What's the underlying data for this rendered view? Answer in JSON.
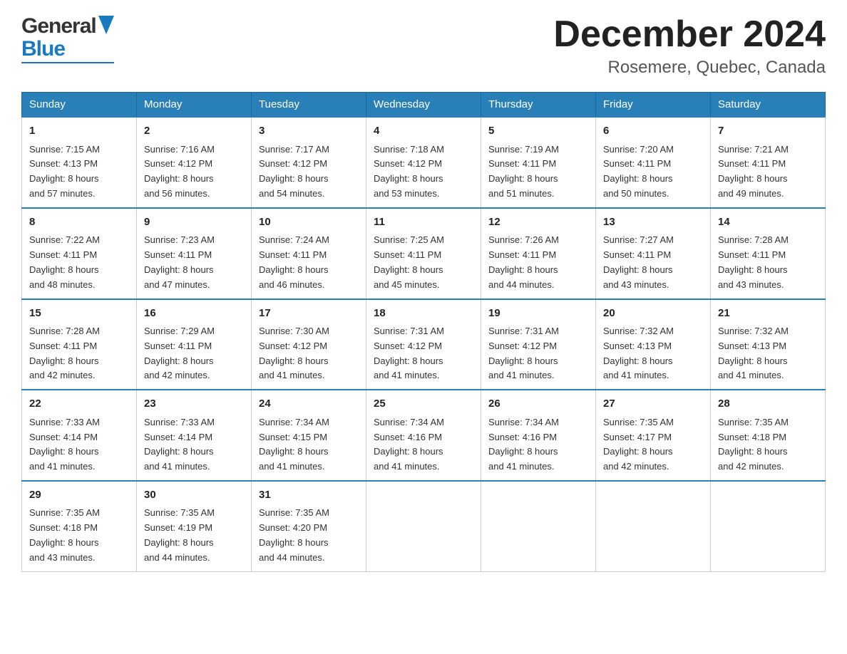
{
  "header": {
    "logo": {
      "general": "General",
      "blue": "Blue"
    },
    "month": "December 2024",
    "location": "Rosemere, Quebec, Canada"
  },
  "weekdays": [
    "Sunday",
    "Monday",
    "Tuesday",
    "Wednesday",
    "Thursday",
    "Friday",
    "Saturday"
  ],
  "weeks": [
    [
      {
        "day": "1",
        "sunrise": "Sunrise: 7:15 AM",
        "sunset": "Sunset: 4:13 PM",
        "daylight": "Daylight: 8 hours",
        "minutes": "and 57 minutes."
      },
      {
        "day": "2",
        "sunrise": "Sunrise: 7:16 AM",
        "sunset": "Sunset: 4:12 PM",
        "daylight": "Daylight: 8 hours",
        "minutes": "and 56 minutes."
      },
      {
        "day": "3",
        "sunrise": "Sunrise: 7:17 AM",
        "sunset": "Sunset: 4:12 PM",
        "daylight": "Daylight: 8 hours",
        "minutes": "and 54 minutes."
      },
      {
        "day": "4",
        "sunrise": "Sunrise: 7:18 AM",
        "sunset": "Sunset: 4:12 PM",
        "daylight": "Daylight: 8 hours",
        "minutes": "and 53 minutes."
      },
      {
        "day": "5",
        "sunrise": "Sunrise: 7:19 AM",
        "sunset": "Sunset: 4:11 PM",
        "daylight": "Daylight: 8 hours",
        "minutes": "and 51 minutes."
      },
      {
        "day": "6",
        "sunrise": "Sunrise: 7:20 AM",
        "sunset": "Sunset: 4:11 PM",
        "daylight": "Daylight: 8 hours",
        "minutes": "and 50 minutes."
      },
      {
        "day": "7",
        "sunrise": "Sunrise: 7:21 AM",
        "sunset": "Sunset: 4:11 PM",
        "daylight": "Daylight: 8 hours",
        "minutes": "and 49 minutes."
      }
    ],
    [
      {
        "day": "8",
        "sunrise": "Sunrise: 7:22 AM",
        "sunset": "Sunset: 4:11 PM",
        "daylight": "Daylight: 8 hours",
        "minutes": "and 48 minutes."
      },
      {
        "day": "9",
        "sunrise": "Sunrise: 7:23 AM",
        "sunset": "Sunset: 4:11 PM",
        "daylight": "Daylight: 8 hours",
        "minutes": "and 47 minutes."
      },
      {
        "day": "10",
        "sunrise": "Sunrise: 7:24 AM",
        "sunset": "Sunset: 4:11 PM",
        "daylight": "Daylight: 8 hours",
        "minutes": "and 46 minutes."
      },
      {
        "day": "11",
        "sunrise": "Sunrise: 7:25 AM",
        "sunset": "Sunset: 4:11 PM",
        "daylight": "Daylight: 8 hours",
        "minutes": "and 45 minutes."
      },
      {
        "day": "12",
        "sunrise": "Sunrise: 7:26 AM",
        "sunset": "Sunset: 4:11 PM",
        "daylight": "Daylight: 8 hours",
        "minutes": "and 44 minutes."
      },
      {
        "day": "13",
        "sunrise": "Sunrise: 7:27 AM",
        "sunset": "Sunset: 4:11 PM",
        "daylight": "Daylight: 8 hours",
        "minutes": "and 43 minutes."
      },
      {
        "day": "14",
        "sunrise": "Sunrise: 7:28 AM",
        "sunset": "Sunset: 4:11 PM",
        "daylight": "Daylight: 8 hours",
        "minutes": "and 43 minutes."
      }
    ],
    [
      {
        "day": "15",
        "sunrise": "Sunrise: 7:28 AM",
        "sunset": "Sunset: 4:11 PM",
        "daylight": "Daylight: 8 hours",
        "minutes": "and 42 minutes."
      },
      {
        "day": "16",
        "sunrise": "Sunrise: 7:29 AM",
        "sunset": "Sunset: 4:11 PM",
        "daylight": "Daylight: 8 hours",
        "minutes": "and 42 minutes."
      },
      {
        "day": "17",
        "sunrise": "Sunrise: 7:30 AM",
        "sunset": "Sunset: 4:12 PM",
        "daylight": "Daylight: 8 hours",
        "minutes": "and 41 minutes."
      },
      {
        "day": "18",
        "sunrise": "Sunrise: 7:31 AM",
        "sunset": "Sunset: 4:12 PM",
        "daylight": "Daylight: 8 hours",
        "minutes": "and 41 minutes."
      },
      {
        "day": "19",
        "sunrise": "Sunrise: 7:31 AM",
        "sunset": "Sunset: 4:12 PM",
        "daylight": "Daylight: 8 hours",
        "minutes": "and 41 minutes."
      },
      {
        "day": "20",
        "sunrise": "Sunrise: 7:32 AM",
        "sunset": "Sunset: 4:13 PM",
        "daylight": "Daylight: 8 hours",
        "minutes": "and 41 minutes."
      },
      {
        "day": "21",
        "sunrise": "Sunrise: 7:32 AM",
        "sunset": "Sunset: 4:13 PM",
        "daylight": "Daylight: 8 hours",
        "minutes": "and 41 minutes."
      }
    ],
    [
      {
        "day": "22",
        "sunrise": "Sunrise: 7:33 AM",
        "sunset": "Sunset: 4:14 PM",
        "daylight": "Daylight: 8 hours",
        "minutes": "and 41 minutes."
      },
      {
        "day": "23",
        "sunrise": "Sunrise: 7:33 AM",
        "sunset": "Sunset: 4:14 PM",
        "daylight": "Daylight: 8 hours",
        "minutes": "and 41 minutes."
      },
      {
        "day": "24",
        "sunrise": "Sunrise: 7:34 AM",
        "sunset": "Sunset: 4:15 PM",
        "daylight": "Daylight: 8 hours",
        "minutes": "and 41 minutes."
      },
      {
        "day": "25",
        "sunrise": "Sunrise: 7:34 AM",
        "sunset": "Sunset: 4:16 PM",
        "daylight": "Daylight: 8 hours",
        "minutes": "and 41 minutes."
      },
      {
        "day": "26",
        "sunrise": "Sunrise: 7:34 AM",
        "sunset": "Sunset: 4:16 PM",
        "daylight": "Daylight: 8 hours",
        "minutes": "and 41 minutes."
      },
      {
        "day": "27",
        "sunrise": "Sunrise: 7:35 AM",
        "sunset": "Sunset: 4:17 PM",
        "daylight": "Daylight: 8 hours",
        "minutes": "and 42 minutes."
      },
      {
        "day": "28",
        "sunrise": "Sunrise: 7:35 AM",
        "sunset": "Sunset: 4:18 PM",
        "daylight": "Daylight: 8 hours",
        "minutes": "and 42 minutes."
      }
    ],
    [
      {
        "day": "29",
        "sunrise": "Sunrise: 7:35 AM",
        "sunset": "Sunset: 4:18 PM",
        "daylight": "Daylight: 8 hours",
        "minutes": "and 43 minutes."
      },
      {
        "day": "30",
        "sunrise": "Sunrise: 7:35 AM",
        "sunset": "Sunset: 4:19 PM",
        "daylight": "Daylight: 8 hours",
        "minutes": "and 44 minutes."
      },
      {
        "day": "31",
        "sunrise": "Sunrise: 7:35 AM",
        "sunset": "Sunset: 4:20 PM",
        "daylight": "Daylight: 8 hours",
        "minutes": "and 44 minutes."
      },
      null,
      null,
      null,
      null
    ]
  ]
}
